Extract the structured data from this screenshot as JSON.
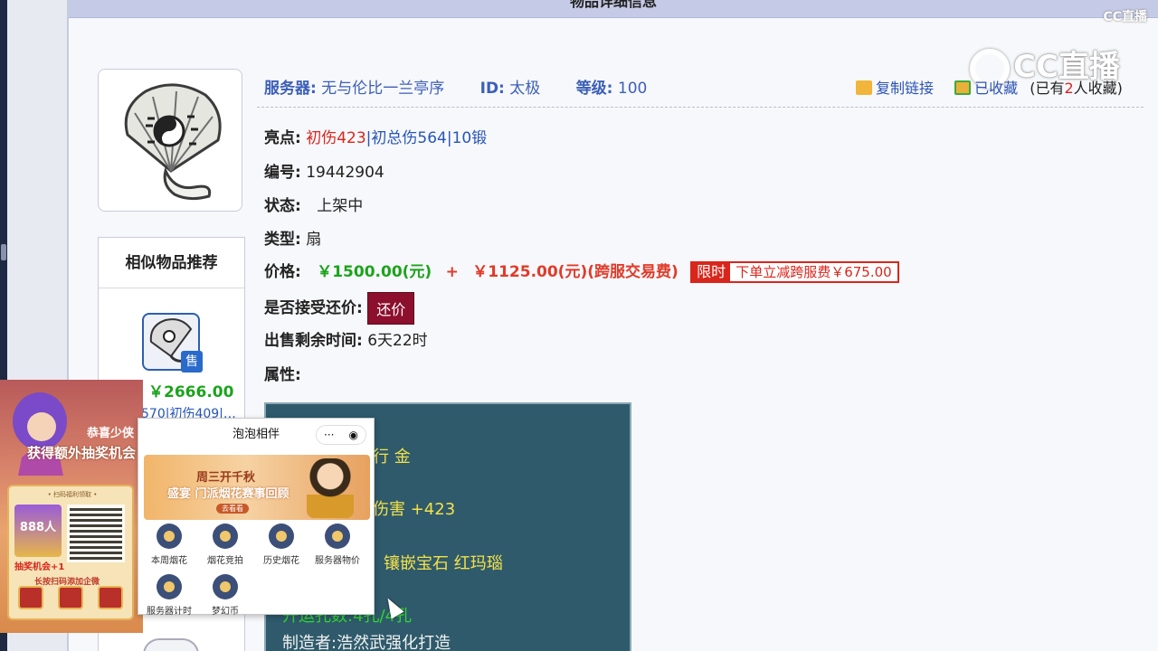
{
  "panel": {
    "title": "物品详细信息"
  },
  "watermark": {
    "small": "CC直播",
    "big": "CC直播"
  },
  "server_line": {
    "server_label": "服务器:",
    "server_value": "无与伦比一兰亭序",
    "id_label": "ID:",
    "id_value": "太极",
    "level_label": "等级:",
    "level_value": "100"
  },
  "actions": {
    "copy_link": "复制链接",
    "favorited": "已收藏",
    "fav_prefix": "(已有",
    "fav_count": "2",
    "fav_suffix": "人收藏)"
  },
  "details": {
    "highlight_label": "亮点:",
    "highlight_1": "初伤423",
    "highlight_sep1": "|",
    "highlight_2": "初总伤564",
    "highlight_sep2": "|",
    "highlight_3": "10锻",
    "number_label": "编号:",
    "number_value": "19442904",
    "status_label": "状态:",
    "status_value": "上架中",
    "type_label": "类型:",
    "type_value": "扇",
    "price_label": "价格:",
    "price_main": "￥1500.00(元)",
    "price_plus": "+",
    "price_fee": "￥1125.00(元)(跨服交易费)",
    "promo_tag": "限时",
    "promo_text": "下单立减跨服费￥675.00",
    "counter_label": "是否接受还价:",
    "counter_button": "还价",
    "remaining_label": "出售剩余时间:",
    "remaining_value": "6天22时",
    "attr_label": "属性:"
  },
  "attributes": {
    "line1": "行 金",
    "line2": "伤害 +423",
    "line3": "镶嵌宝石 红玛瑙",
    "line4": "开运孔数:4孔/4孔",
    "line5": "制造者:浩然武强化打造"
  },
  "similar": {
    "title": "相似物品推荐",
    "badge": "售",
    "price": "￥2666.00",
    "highlight": "570|初伤409|…"
  },
  "promo_card": {
    "congrats": "恭喜少侠",
    "gain": "获得额外抽奖机会",
    "inner_top": "• 扫码福利领取 •",
    "ticket": "888人",
    "plus_one": "抽奖机会+1",
    "scan": "长按扫码添加企微"
  },
  "mini_app": {
    "title": "泡泡相伴",
    "caps_more": "···",
    "caps_close": "◉",
    "banner_t1": "周三开千秋",
    "banner_t2": "盛宴 门派烟花赛事回顾",
    "banner_t3": "去看看",
    "items": [
      "本周烟花",
      "烟花竞拍",
      "历史烟花",
      "服务器物价",
      "服务器计时",
      "梦幻币"
    ]
  }
}
